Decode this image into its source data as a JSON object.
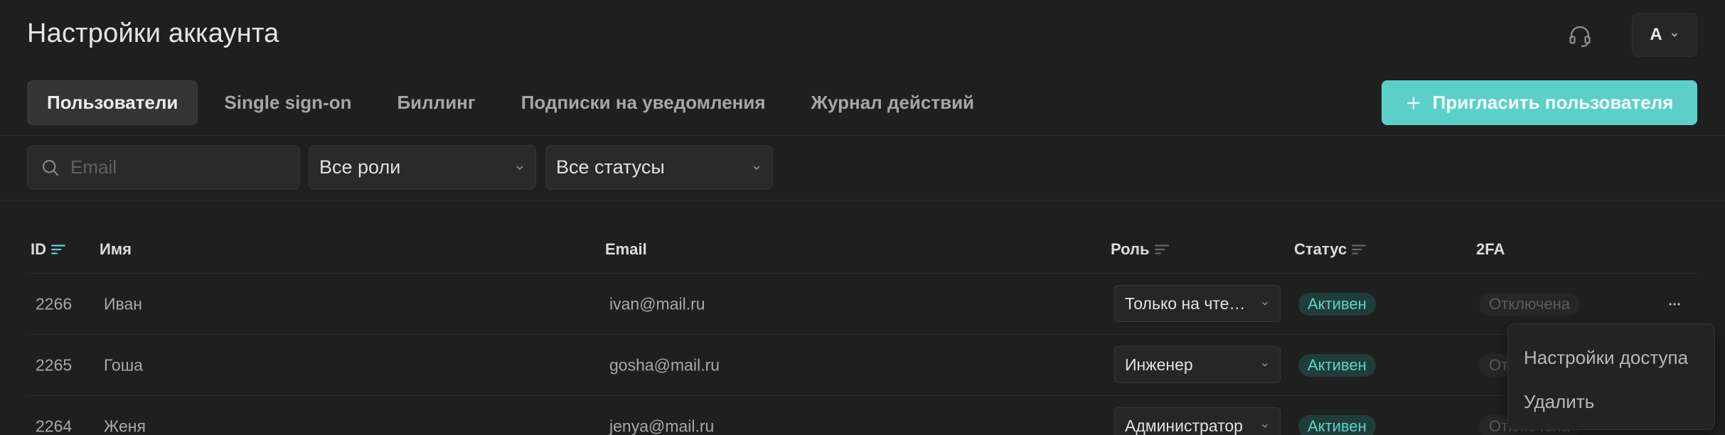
{
  "page": {
    "title": "Настройки аккаунта"
  },
  "header": {
    "user_initial": "А"
  },
  "tabs": [
    {
      "label": "Пользователи",
      "active": true
    },
    {
      "label": "Single sign-on",
      "active": false
    },
    {
      "label": "Биллинг",
      "active": false
    },
    {
      "label": "Подписки на уведомления",
      "active": false
    },
    {
      "label": "Журнал действий",
      "active": false
    }
  ],
  "invite_button": {
    "label": "Пригласить пользователя",
    "icon": "plus-icon"
  },
  "filters": {
    "search_placeholder": "Email",
    "search_value": "",
    "role_select": "Все роли",
    "status_select": "Все статусы"
  },
  "table": {
    "columns": [
      "ID",
      "Имя",
      "Email",
      "Роль",
      "Статус",
      "2FA"
    ],
    "rows": [
      {
        "id": "2266",
        "name": "Иван",
        "email": "ivan@mail.ru",
        "role": "Только на чтение",
        "status": "Активен",
        "tfa": "Отключена"
      },
      {
        "id": "2265",
        "name": "Гоша",
        "email": "gosha@mail.ru",
        "role": "Инженер",
        "status": "Активен",
        "tfa": "Отключена"
      },
      {
        "id": "2264",
        "name": "Женя",
        "email": "jenya@mail.ru",
        "role": "Администратор",
        "status": "Активен",
        "tfa": "Отключена"
      }
    ]
  },
  "row_menu": {
    "items": [
      "Настройки доступа",
      "Удалить"
    ]
  },
  "colors": {
    "accent": "#5cd0c8",
    "background": "#1f1f1f",
    "status_active": "#5fd3c6"
  }
}
